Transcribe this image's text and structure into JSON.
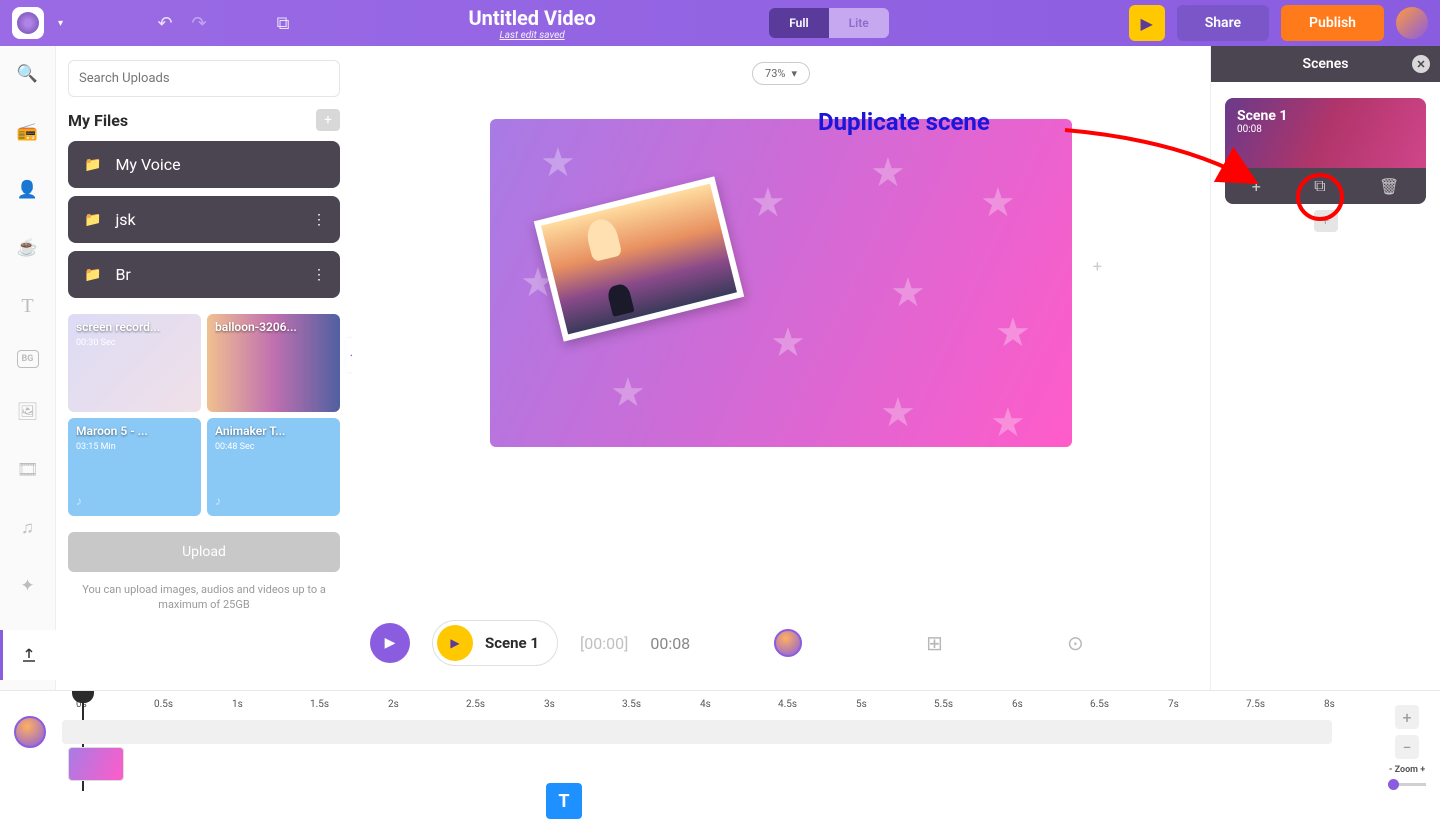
{
  "topbar": {
    "title": "Untitled Video",
    "subtitle": "Last edit saved",
    "mode_full": "Full",
    "mode_lite": "Lite",
    "share": "Share",
    "publish": "Publish"
  },
  "panel": {
    "search_ph": "Search Uploads",
    "heading": "My Files",
    "folders": [
      "My Voice",
      "jsk",
      "Br"
    ],
    "tiles": [
      {
        "name": "screen record...",
        "dur": "00:30 Sec"
      },
      {
        "name": "balloon-3206...",
        "dur": ""
      },
      {
        "name": "Maroon 5 - ...",
        "dur": "03:15 Min"
      },
      {
        "name": "Animaker T...",
        "dur": "00:48 Sec"
      }
    ],
    "upload": "Upload",
    "hint": "You can upload images, audios and videos up to a maximum of 25GB"
  },
  "canvas": {
    "zoom": "73%"
  },
  "playbar": {
    "scene": "Scene 1",
    "cur": "[00:00]",
    "dur": "00:08"
  },
  "scenes": {
    "title": "Scenes",
    "card_name": "Scene 1",
    "card_time": "00:08"
  },
  "timeline": {
    "ticks": [
      "0s",
      "0.5s",
      "1s",
      "1.5s",
      "2s",
      "2.5s",
      "3s",
      "3.5s",
      "4s",
      "4.5s",
      "5s",
      "5.5s",
      "6s",
      "6.5s",
      "7s",
      "7.5s",
      "8s"
    ],
    "zoom_label": "- Zoom +",
    "t_badge": "T"
  },
  "annotation": {
    "text": "Duplicate scene"
  }
}
